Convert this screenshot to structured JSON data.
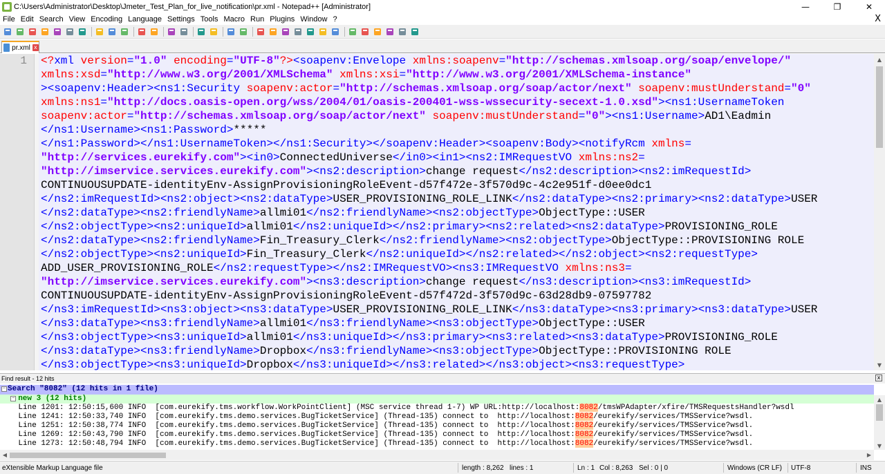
{
  "window": {
    "title": "C:\\Users\\Administrator\\Desktop\\Jmeter_Test_Plan_for_live_notification\\pr.xml - Notepad++ [Administrator]",
    "minimize": "—",
    "maximize": "❐",
    "close": "✕"
  },
  "menu": {
    "items": [
      "File",
      "Edit",
      "Search",
      "View",
      "Encoding",
      "Language",
      "Settings",
      "Tools",
      "Macro",
      "Run",
      "Plugins",
      "Window",
      "?"
    ],
    "close_glyph": "X"
  },
  "tab": {
    "label": "pr.xml",
    "close_glyph": "x"
  },
  "editor": {
    "line_number": "1",
    "lines": [
      [
        [
          "pi",
          "<?"
        ],
        [
          "tag",
          "xml "
        ],
        [
          "attr",
          "version"
        ],
        [
          "tag",
          "="
        ],
        [
          "val",
          "\"1.0\""
        ],
        [
          "tag",
          " "
        ],
        [
          "attr",
          "encoding"
        ],
        [
          "tag",
          "="
        ],
        [
          "val",
          "\"UTF-8\""
        ],
        [
          "pi",
          "?>"
        ],
        [
          "tag",
          "<soapenv:Envelope "
        ],
        [
          "attr",
          "xmlns:soapenv"
        ],
        [
          "tag",
          "="
        ],
        [
          "val",
          "\"http://schemas.xmlsoap.org/soap/envelope/\""
        ]
      ],
      [
        [
          "attr",
          "xmlns:xsd"
        ],
        [
          "tag",
          "="
        ],
        [
          "val",
          "\"http://www.w3.org/2001/XMLSchema\""
        ],
        [
          "tag",
          " "
        ],
        [
          "attr",
          "xmlns:xsi"
        ],
        [
          "tag",
          "="
        ],
        [
          "val",
          "\"http://www.w3.org/2001/XMLSchema-instance\""
        ]
      ],
      [
        [
          "tag",
          "><soapenv:Header><ns1:Security "
        ],
        [
          "attr",
          "soapenv:actor"
        ],
        [
          "tag",
          "="
        ],
        [
          "val",
          "\"http://schemas.xmlsoap.org/soap/actor/next\""
        ],
        [
          "tag",
          " "
        ],
        [
          "attr",
          "soapenv:mustUnderstand"
        ],
        [
          "tag",
          "="
        ],
        [
          "val",
          "\"0\""
        ]
      ],
      [
        [
          "attr",
          "xmlns:ns1"
        ],
        [
          "tag",
          "="
        ],
        [
          "val",
          "\"http://docs.oasis-open.org/wss/2004/01/oasis-200401-wss-wssecurity-secext-1.0.xsd\""
        ],
        [
          "tag",
          "><ns1:UsernameToken"
        ]
      ],
      [
        [
          "attr",
          "soapenv:actor"
        ],
        [
          "tag",
          "="
        ],
        [
          "val",
          "\"http://schemas.xmlsoap.org/soap/actor/next\""
        ],
        [
          "tag",
          " "
        ],
        [
          "attr",
          "soapenv:mustUnderstand"
        ],
        [
          "tag",
          "="
        ],
        [
          "val",
          "\"0\""
        ],
        [
          "tag",
          "><ns1:Username>"
        ],
        [
          "text",
          "AD1\\Eadmin"
        ]
      ],
      [
        [
          "tag",
          "</ns1:Username><ns1:Password>"
        ],
        [
          "text",
          "*****"
        ]
      ],
      [
        [
          "tag",
          "</ns1:Password></ns1:UsernameToken></ns1:Security></soapenv:Header><soapenv:Body><notifyRcm "
        ],
        [
          "attr",
          "xmlns"
        ],
        [
          "tag",
          "="
        ]
      ],
      [
        [
          "val",
          "\"http://services.eurekify.com\""
        ],
        [
          "tag",
          "><in0>"
        ],
        [
          "text",
          "ConnectedUniverse"
        ],
        [
          "tag",
          "</in0><in1><ns2:IMRequestVO "
        ],
        [
          "attr",
          "xmlns:ns2"
        ],
        [
          "tag",
          "="
        ]
      ],
      [
        [
          "val",
          "\"http://imservice.services.eurekify.com\""
        ],
        [
          "tag",
          "><ns2:description>"
        ],
        [
          "text",
          "change request"
        ],
        [
          "tag",
          "</ns2:description><ns2:imRequestId>"
        ]
      ],
      [
        [
          "text",
          "CONTINUOUSUPDATE-identityEnv-AssignProvisioningRoleEvent-d57f472e-3f570d9c-4c2e951f-d0ee0dc1"
        ]
      ],
      [
        [
          "tag",
          "</ns2:imRequestId><ns2:object><ns2:dataType>"
        ],
        [
          "text",
          "USER_PROVISIONING_ROLE_LINK"
        ],
        [
          "tag",
          "</ns2:dataType><ns2:primary><ns2:dataType>"
        ],
        [
          "text",
          "USER"
        ]
      ],
      [
        [
          "tag",
          "</ns2:dataType><ns2:friendlyName>"
        ],
        [
          "text",
          "allmi01"
        ],
        [
          "tag",
          "</ns2:friendlyName><ns2:objectType>"
        ],
        [
          "text",
          "ObjectType::USER"
        ]
      ],
      [
        [
          "tag",
          "</ns2:objectType><ns2:uniqueId>"
        ],
        [
          "text",
          "allmi01"
        ],
        [
          "tag",
          "</ns2:uniqueId></ns2:primary><ns2:related><ns2:dataType>"
        ],
        [
          "text",
          "PROVISIONING_ROLE"
        ]
      ],
      [
        [
          "tag",
          "</ns2:dataType><ns2:friendlyName>"
        ],
        [
          "text",
          "Fin_Treasury_Clerk"
        ],
        [
          "tag",
          "</ns2:friendlyName><ns2:objectType>"
        ],
        [
          "text",
          "ObjectType::PROVISIONING ROLE"
        ]
      ],
      [
        [
          "tag",
          "</ns2:objectType><ns2:uniqueId>"
        ],
        [
          "text",
          "Fin_Treasury_Clerk"
        ],
        [
          "tag",
          "</ns2:uniqueId></ns2:related></ns2:object><ns2:requestType>"
        ]
      ],
      [
        [
          "text",
          "ADD_USER_PROVISIONING_ROLE"
        ],
        [
          "tag",
          "</ns2:requestType></ns2:IMRequestVO><ns3:IMRequestVO "
        ],
        [
          "attr",
          "xmlns:ns3"
        ],
        [
          "tag",
          "="
        ]
      ],
      [
        [
          "val",
          "\"http://imservice.services.eurekify.com\""
        ],
        [
          "tag",
          "><ns3:description>"
        ],
        [
          "text",
          "change request"
        ],
        [
          "tag",
          "</ns3:description><ns3:imRequestId>"
        ]
      ],
      [
        [
          "text",
          "CONTINUOUSUPDATE-identityEnv-AssignProvisioningRoleEvent-d57f472d-3f570d9c-63d28db9-07597782"
        ]
      ],
      [
        [
          "tag",
          "</ns3:imRequestId><ns3:object><ns3:dataType>"
        ],
        [
          "text",
          "USER_PROVISIONING_ROLE_LINK"
        ],
        [
          "tag",
          "</ns3:dataType><ns3:primary><ns3:dataType>"
        ],
        [
          "text",
          "USER"
        ]
      ],
      [
        [
          "tag",
          "</ns3:dataType><ns3:friendlyName>"
        ],
        [
          "text",
          "allmi01"
        ],
        [
          "tag",
          "</ns3:friendlyName><ns3:objectType>"
        ],
        [
          "text",
          "ObjectType::USER"
        ]
      ],
      [
        [
          "tag",
          "</ns3:objectType><ns3:uniqueId>"
        ],
        [
          "text",
          "allmi01"
        ],
        [
          "tag",
          "</ns3:uniqueId></ns3:primary><ns3:related><ns3:dataType>"
        ],
        [
          "text",
          "PROVISIONING_ROLE"
        ]
      ],
      [
        [
          "tag",
          "</ns3:dataType><ns3:friendlyName>"
        ],
        [
          "text",
          "Dropbox"
        ],
        [
          "tag",
          "</ns3:friendlyName><ns3:objectType>"
        ],
        [
          "text",
          "ObjectType::PROVISIONING ROLE"
        ]
      ],
      [
        [
          "tag",
          "</ns3:objectType><ns3:uniqueId>"
        ],
        [
          "text",
          "Dropbox"
        ],
        [
          "tag",
          "</ns3:uniqueId></ns3:related></ns3:object><ns3:requestType>"
        ]
      ]
    ]
  },
  "find_results": {
    "panel_title": "Find result - 12 hits",
    "search_summary": "Search \"8082\" (12 hits in 1 file)",
    "file_summary": "new 3 (12 hits)",
    "hits": [
      {
        "prefix": "    Line 1201: 12:50:15,600 INFO  [com.eurekify.tms.workflow.WorkPointClient] (MSC service thread 1-7) WP URL:http://localhost:",
        "match": "8082",
        "suffix": "/tmsWPAdapter/xfire/TMSRequestsHandler?wsdl"
      },
      {
        "prefix": "    Line 1241: 12:50:33,740 INFO  [com.eurekify.tms.demo.services.BugTicketService] (Thread-135) connect to  http://localhost:",
        "match": "8082",
        "suffix": "/eurekify/services/TMSService?wsdl."
      },
      {
        "prefix": "    Line 1251: 12:50:38,774 INFO  [com.eurekify.tms.demo.services.BugTicketService] (Thread-135) connect to  http://localhost:",
        "match": "8082",
        "suffix": "/eurekify/services/TMSService?wsdl."
      },
      {
        "prefix": "    Line 1269: 12:50:43,790 INFO  [com.eurekify.tms.demo.services.BugTicketService] (Thread-135) connect to  http://localhost:",
        "match": "8082",
        "suffix": "/eurekify/services/TMSService?wsdl."
      },
      {
        "prefix": "    Line 1273: 12:50:48,794 INFO  [com.eurekify.tms.demo.services.BugTicketService] (Thread-135) connect to  http://localhost:",
        "match": "8082",
        "suffix": "/eurekify/services/TMSService?wsdl."
      }
    ]
  },
  "status": {
    "file_type": "eXtensible Markup Language file",
    "length": "length : 8,262",
    "lines": "lines : 1",
    "ln": "Ln : 1",
    "col": "Col : 8,263",
    "sel": "Sel : 0 | 0",
    "eol": "Windows (CR LF)",
    "encoding": "UTF-8",
    "mode": "INS"
  },
  "toolbar_icons": [
    "new-file-icon",
    "open-file-icon",
    "save-icon",
    "save-all-icon",
    "close-icon",
    "close-all-icon",
    "print-icon",
    "cut-icon",
    "copy-icon",
    "paste-icon",
    "undo-icon",
    "redo-icon",
    "find-icon",
    "replace-icon",
    "zoom-in-icon",
    "zoom-out-icon",
    "sync-vertical-icon",
    "sync-horizontal-icon",
    "word-wrap-icon",
    "show-all-chars-icon",
    "indent-guide-icon",
    "udl-icon",
    "doc-map-icon",
    "function-list-icon",
    "folder-workspace-icon",
    "monitor-icon",
    "record-macro-icon",
    "stop-record-icon",
    "play-macro-icon",
    "run-macro-multiple-icon",
    "save-macro-icon"
  ]
}
